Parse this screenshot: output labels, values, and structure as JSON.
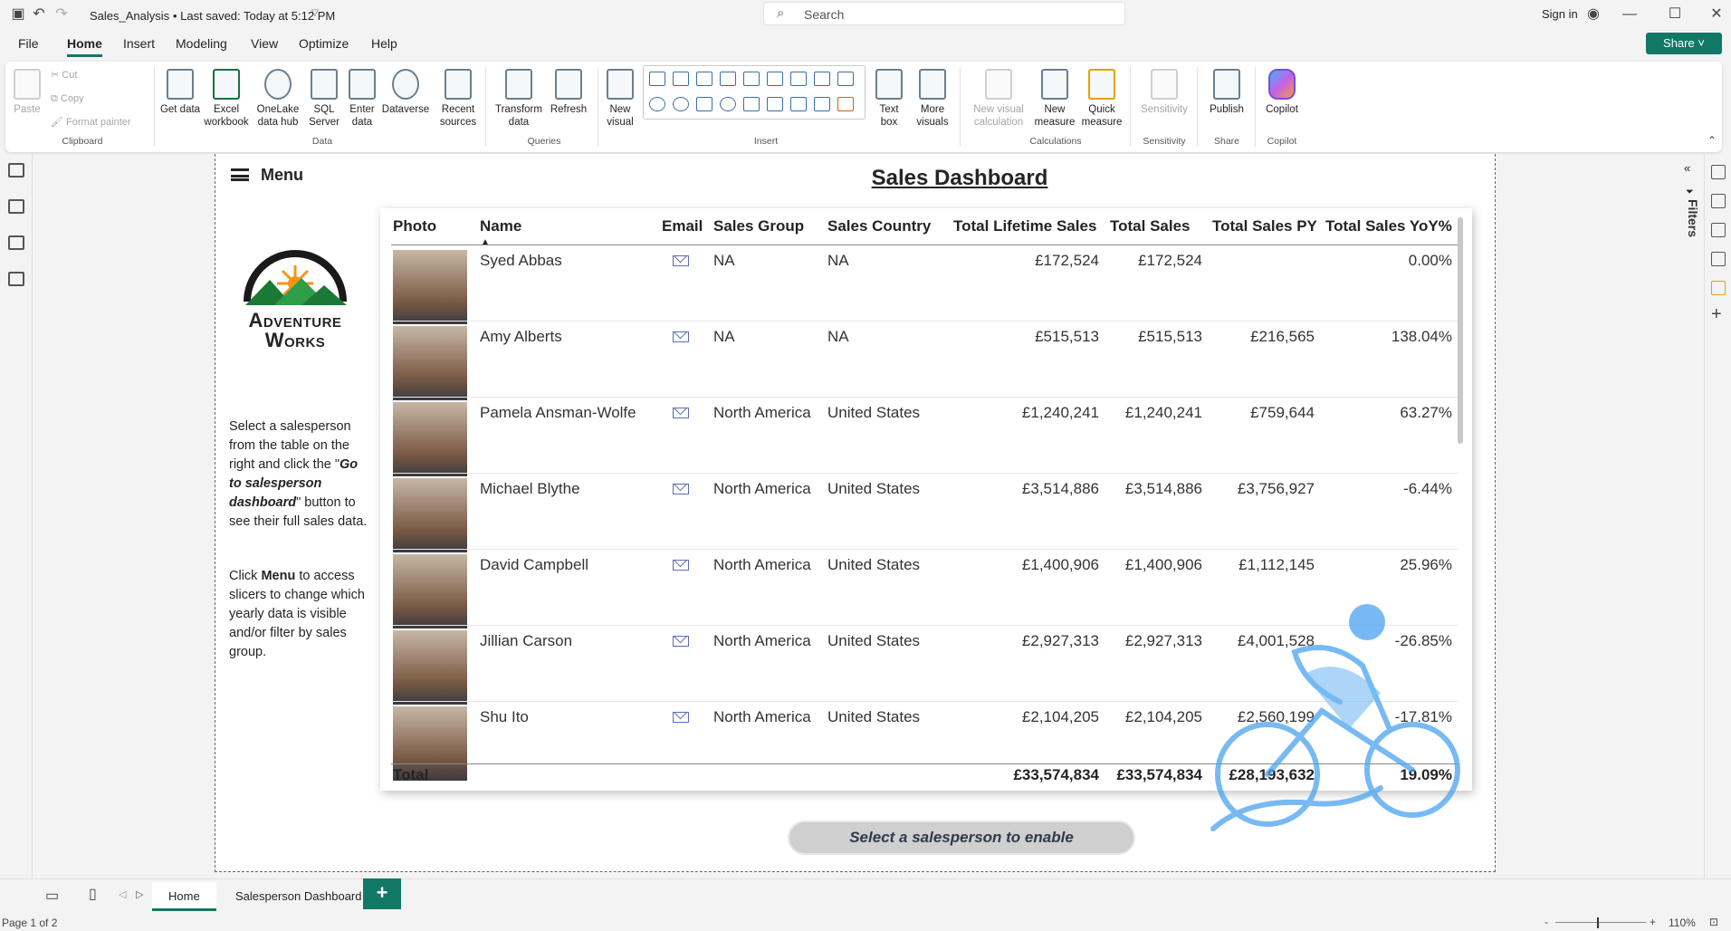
{
  "titlebar": {
    "filename": "Sales_Analysis",
    "saved_status": "• Last saved: Today at 5:12 PM",
    "search_placeholder": "Search",
    "signin": "Sign in"
  },
  "menu": {
    "tabs": [
      "File",
      "Home",
      "Insert",
      "Modeling",
      "View",
      "Optimize",
      "Help"
    ],
    "active": "Home",
    "share": "Share"
  },
  "ribbon": {
    "clipboard": {
      "paste": "Paste",
      "cut": "Cut",
      "copy": "Copy",
      "format_painter": "Format painter",
      "group": "Clipboard"
    },
    "data": {
      "get_data": "Get data",
      "excel": "Excel workbook",
      "onelake": "OneLake data hub",
      "sql": "SQL Server",
      "enter": "Enter data",
      "dataverse": "Dataverse",
      "recent": "Recent sources",
      "group": "Data"
    },
    "queries": {
      "transform": "Transform data",
      "refresh": "Refresh",
      "group": "Queries"
    },
    "insert": {
      "new_visual": "New visual",
      "text_box": "Text box",
      "more_visuals": "More visuals",
      "group": "Insert"
    },
    "calculations": {
      "new_visual_calc": "New visual calculation",
      "new_measure": "New measure",
      "quick_measure": "Quick measure",
      "group": "Calculations"
    },
    "sensitivity": {
      "label": "Sensitivity",
      "group": "Sensitivity"
    },
    "share": {
      "publish": "Publish",
      "group": "Share"
    },
    "copilot": {
      "label": "Copilot",
      "group": "Copilot"
    }
  },
  "report": {
    "menu_label": "Menu",
    "title": "Sales Dashboard",
    "logo_text_1": "Adventure",
    "logo_text_2": "Works",
    "instructions_1a": "Select a salesperson from the table on the right and click the \"",
    "instructions_1b": "Go to salesperson dashboard",
    "instructions_1c": "\" button to see their full sales data.",
    "instructions_2a": "Click ",
    "instructions_2b": "Menu",
    "instructions_2c": " to access slicers to change which yearly data is visible and/or filter by sales group.",
    "button_label": "Select a salesperson to enable"
  },
  "table": {
    "headers": [
      "Photo",
      "Name",
      "Email",
      "Sales Group",
      "Sales Country",
      "Total Lifetime Sales",
      "Total Sales",
      "Total Sales PY",
      "Total Sales YoY%"
    ],
    "rows": [
      {
        "name": "Syed Abbas",
        "group": "NA",
        "country": "NA",
        "lifetime": "£172,524",
        "sales": "£172,524",
        "py": "",
        "yoy": "0.00%"
      },
      {
        "name": "Amy Alberts",
        "group": "NA",
        "country": "NA",
        "lifetime": "£515,513",
        "sales": "£515,513",
        "py": "£216,565",
        "yoy": "138.04%"
      },
      {
        "name": "Pamela Ansman-Wolfe",
        "group": "North America",
        "country": "United States",
        "lifetime": "£1,240,241",
        "sales": "£1,240,241",
        "py": "£759,644",
        "yoy": "63.27%"
      },
      {
        "name": "Michael Blythe",
        "group": "North America",
        "country": "United States",
        "lifetime": "£3,514,886",
        "sales": "£3,514,886",
        "py": "£3,756,927",
        "yoy": "-6.44%"
      },
      {
        "name": "David Campbell",
        "group": "North America",
        "country": "United States",
        "lifetime": "£1,400,906",
        "sales": "£1,400,906",
        "py": "£1,112,145",
        "yoy": "25.96%"
      },
      {
        "name": "Jillian Carson",
        "group": "North America",
        "country": "United States",
        "lifetime": "£2,927,313",
        "sales": "£2,927,313",
        "py": "£4,001,528",
        "yoy": "-26.85%"
      },
      {
        "name": "Shu Ito",
        "group": "North America",
        "country": "United States",
        "lifetime": "£2,104,205",
        "sales": "£2,104,205",
        "py": "£2,560,199",
        "yoy": "-17.81%"
      }
    ],
    "total": {
      "label": "Total",
      "lifetime": "£33,574,834",
      "sales": "£33,574,834",
      "py": "£28,193,632",
      "yoy": "19.09%"
    }
  },
  "right_pane": {
    "filters": "Filters"
  },
  "page_tabs": {
    "tabs": [
      "Home",
      "Salesperson Dashboard"
    ],
    "active": "Home",
    "add": "+"
  },
  "status": {
    "page": "Page 1 of 2",
    "zoom": "110%"
  },
  "colors": {
    "accent": "#117865",
    "logo_green": "#2e9e48",
    "logo_orange": "#f7941d",
    "bike_blue": "#4aa3f0"
  }
}
